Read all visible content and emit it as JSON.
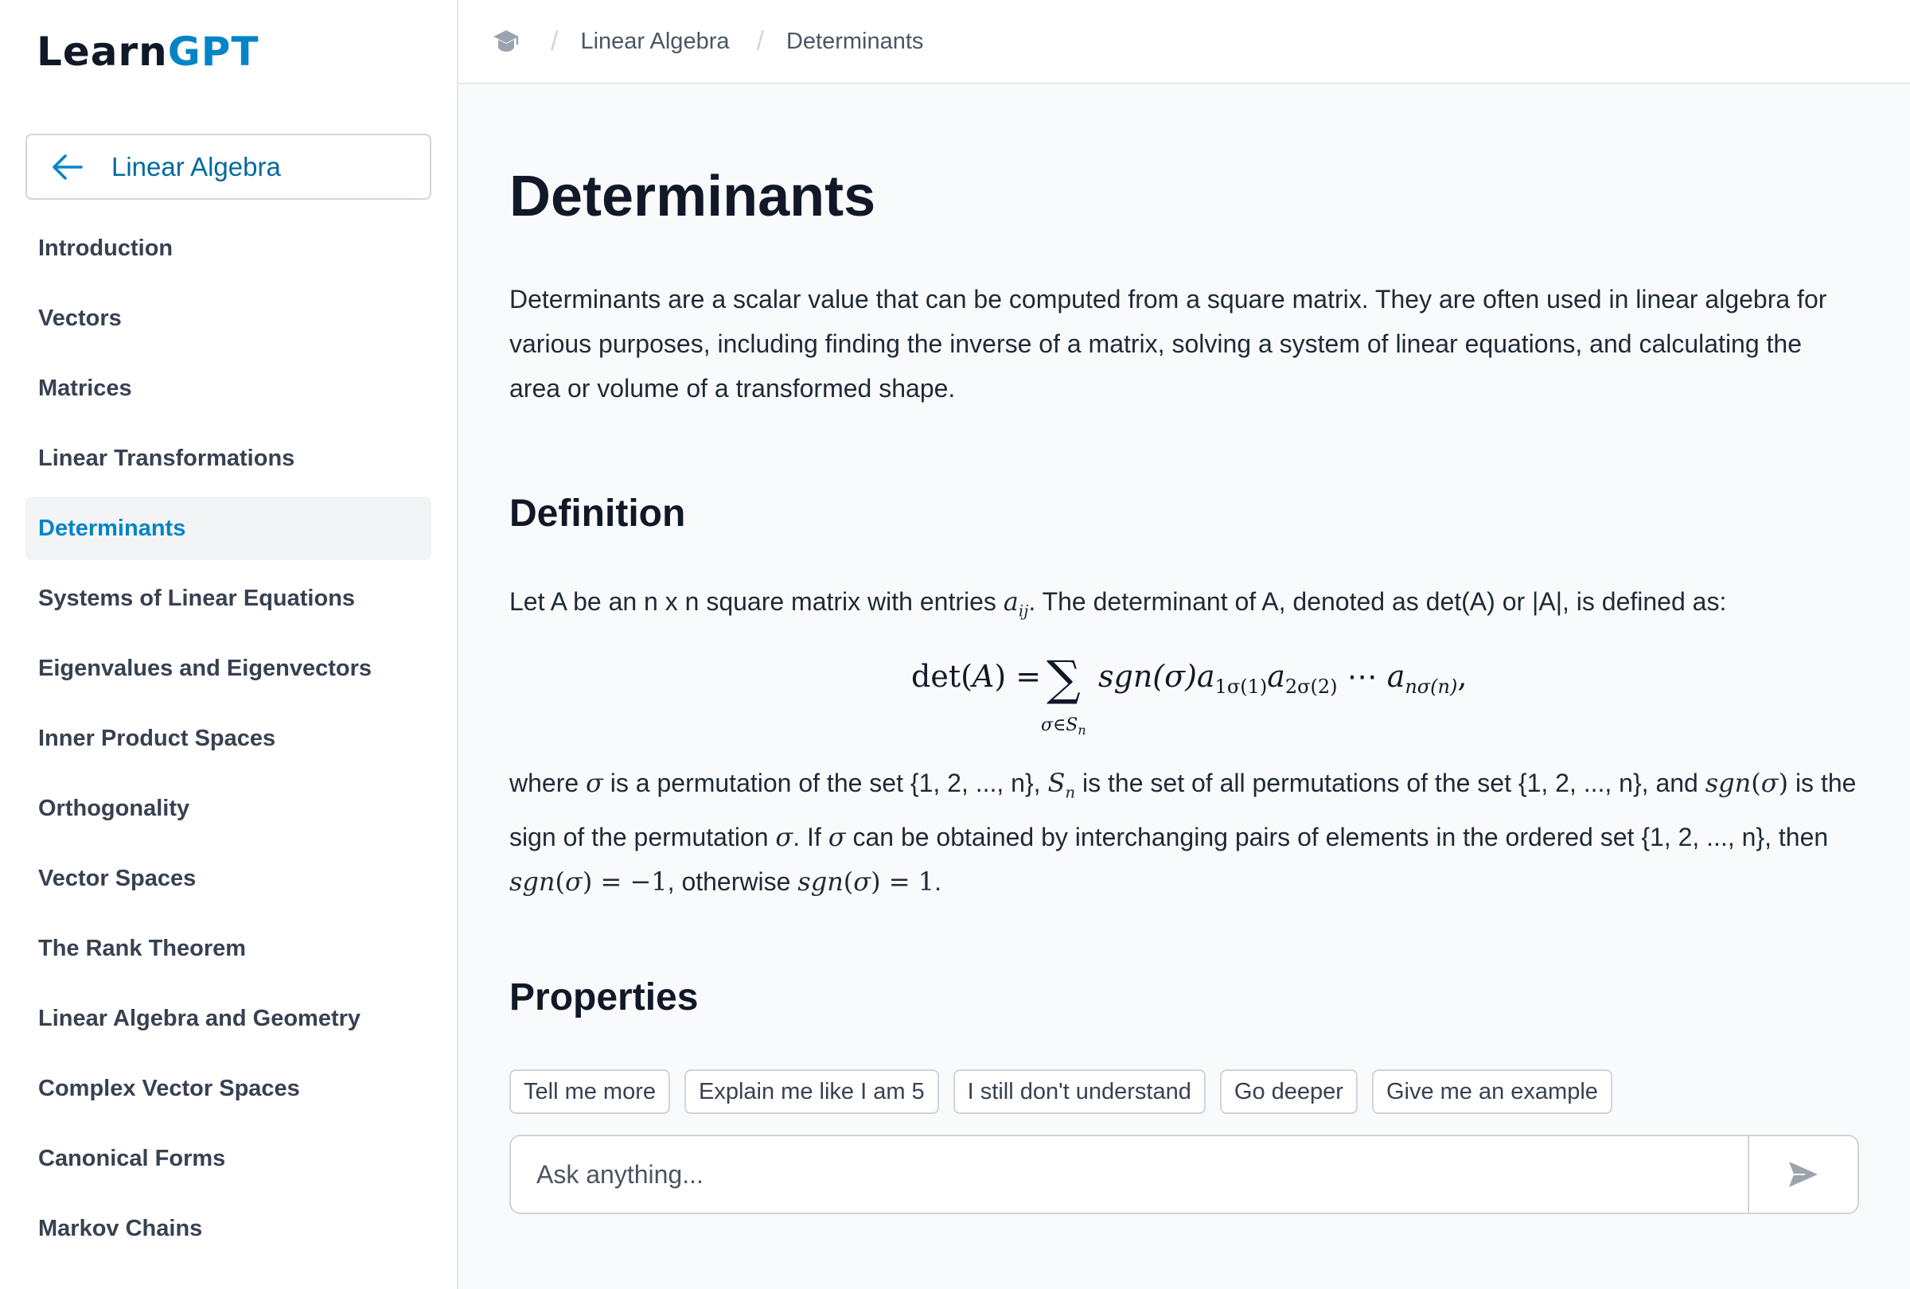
{
  "app": {
    "logo_part1": "Learn",
    "logo_part2": "GPT"
  },
  "sidebar": {
    "back_label": "Linear Algebra",
    "items": [
      {
        "label": "Introduction"
      },
      {
        "label": "Vectors"
      },
      {
        "label": "Matrices"
      },
      {
        "label": "Linear Transformations"
      },
      {
        "label": "Determinants",
        "active": true
      },
      {
        "label": "Systems of Linear Equations"
      },
      {
        "label": "Eigenvalues and Eigenvectors"
      },
      {
        "label": "Inner Product Spaces"
      },
      {
        "label": "Orthogonality"
      },
      {
        "label": "Vector Spaces"
      },
      {
        "label": "The Rank Theorem"
      },
      {
        "label": "Linear Algebra and Geometry"
      },
      {
        "label": "Complex Vector Spaces"
      },
      {
        "label": "Canonical Forms"
      },
      {
        "label": "Markov Chains"
      }
    ]
  },
  "breadcrumb": {
    "course": "Linear Algebra",
    "page": "Determinants"
  },
  "content": {
    "title": "Determinants",
    "intro": "Determinants are a scalar value that can be computed from a square matrix. They are often used in linear algebra for various purposes, including finding the inverse of a matrix, solving a system of linear equations, and calculating the area or volume of a transformed shape.",
    "definition_heading": "Definition",
    "definition_text_a": "Let A be an n x n square matrix with entries ",
    "definition_text_b": ". The determinant of A, denoted as det(A) or |A|, is defined as:",
    "formula": "det(A) = Σ_{σ∈S_n} sgn(σ) a_{1σ(1)} a_{2σ(2)} ⋯ a_{nσ(n)},",
    "explanation_1": "where ",
    "explanation_2": " is a permutation of the set {1, 2, ..., n}, ",
    "explanation_3": " is the set of all permutations of the set {1, 2, ..., n}, and ",
    "explanation_4": " is the sign of the permutation ",
    "explanation_5": ". If ",
    "explanation_6": " can be obtained by interchanging pairs of elements in the ordered set {1, 2, ..., n}, then ",
    "explanation_7": ", otherwise ",
    "explanation_8": ".",
    "properties_heading": "Properties"
  },
  "suggestions": [
    "Tell me more",
    "Explain me like I am 5",
    "I still don't understand",
    "Go deeper",
    "Give me an example"
  ],
  "ask": {
    "placeholder": "Ask anything..."
  },
  "colors": {
    "accent": "#0284c7",
    "text": "#111827",
    "border": "#d1d5db"
  }
}
